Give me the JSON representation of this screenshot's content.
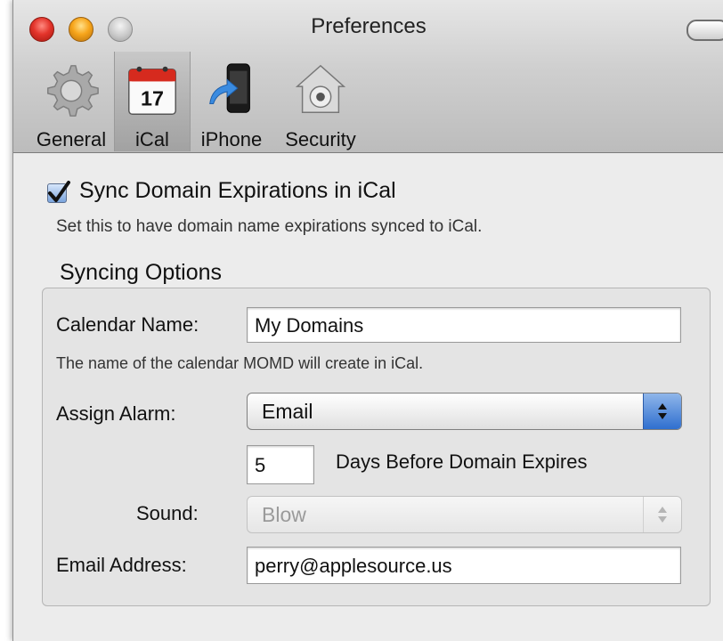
{
  "window": {
    "title": "Preferences"
  },
  "toolbar": {
    "items": [
      {
        "label": "General",
        "icon": "gear-icon"
      },
      {
        "label": "iCal",
        "icon": "calendar-icon",
        "icon_text": "17",
        "selected": true
      },
      {
        "label": "iPhone",
        "icon": "iphone-icon"
      },
      {
        "label": "Security",
        "icon": "house-lock-icon"
      }
    ]
  },
  "sync": {
    "checked": true,
    "label": "Sync Domain Expirations in iCal",
    "description": "Set this to have domain name expirations synced to iCal."
  },
  "options": {
    "title": "Syncing Options",
    "calendar_name_label": "Calendar Name:",
    "calendar_name_value": "My Domains",
    "calendar_hint": "The name of the calendar MOMD will create in iCal.",
    "alarm_label": "Assign Alarm:",
    "alarm_value": "Email",
    "days_value": "5",
    "days_label": "Days Before Domain Expires",
    "sound_label": "Sound:",
    "sound_value": "Blow",
    "email_label": "Email Address:",
    "email_value": "perry@applesource.us"
  },
  "colors": {
    "accent": "#2f6fcf",
    "close": "#e3342b",
    "minimize": "#f7a51b"
  }
}
